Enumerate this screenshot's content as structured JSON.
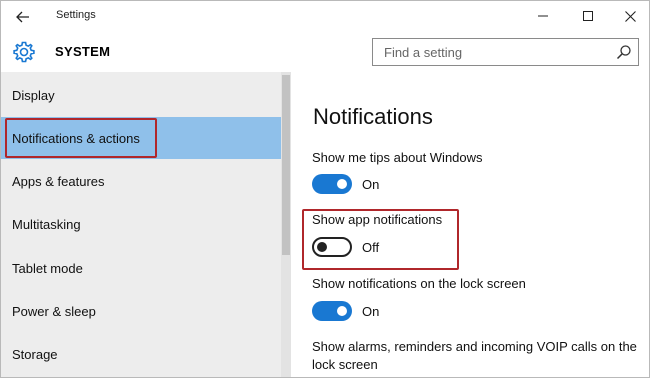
{
  "window": {
    "title": "Settings",
    "controls": {
      "minimize_icon": "minimize-icon",
      "maximize_icon": "maximize-icon",
      "close_icon": "close-icon"
    }
  },
  "header": {
    "section": "SYSTEM",
    "icon": "gear-icon",
    "search": {
      "placeholder": "Find a setting",
      "value": ""
    }
  },
  "sidebar": {
    "items": [
      {
        "label": "Display",
        "active": false
      },
      {
        "label": "Notifications & actions",
        "active": true
      },
      {
        "label": "Apps & features",
        "active": false
      },
      {
        "label": "Multitasking",
        "active": false
      },
      {
        "label": "Tablet mode",
        "active": false
      },
      {
        "label": "Power & sleep",
        "active": false
      },
      {
        "label": "Storage",
        "active": false
      }
    ]
  },
  "main": {
    "title": "Notifications",
    "settings": [
      {
        "label": "Show me tips about Windows",
        "state": "On",
        "on": true
      },
      {
        "label": "Show app notifications",
        "state": "Off",
        "on": false
      },
      {
        "label": "Show notifications on the lock screen",
        "state": "On",
        "on": true
      },
      {
        "label": "Show alarms, reminders and incoming VOIP calls on the lock screen"
      }
    ]
  },
  "colors": {
    "accent": "#1978d2",
    "selected_item": "#8fc0ea",
    "highlight_outline": "#b0272b",
    "sidebar_bg": "#ededed"
  }
}
